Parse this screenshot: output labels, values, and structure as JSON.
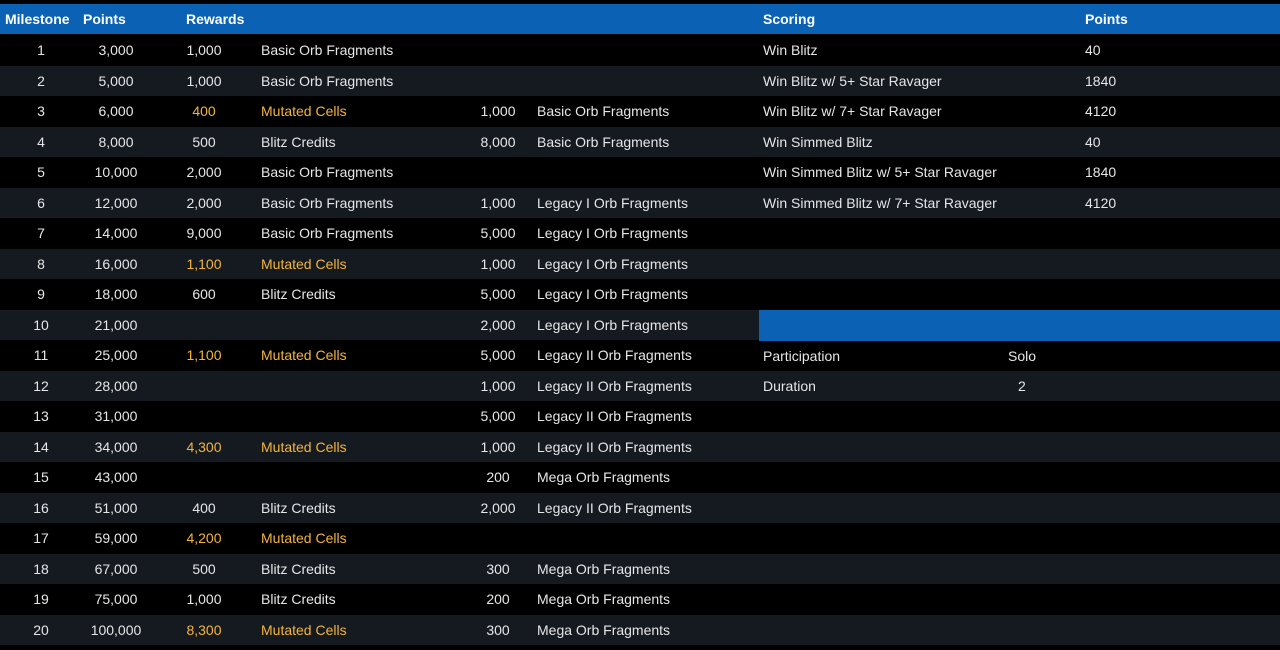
{
  "header": {
    "milestone": "Milestone",
    "points": "Points",
    "rewards": "Rewards",
    "scoring": "Scoring",
    "scoring_points": "Points"
  },
  "colors": {
    "header_bg": "#0b62b5",
    "row_alt": "#151a20",
    "highlight": "#f4b43a"
  },
  "milestones": [
    {
      "ms": "1",
      "pts": "3,000",
      "r1q": "1,000",
      "r1n": "Basic Orb Fragments",
      "r1hl": false,
      "r2q": "",
      "r2n": ""
    },
    {
      "ms": "2",
      "pts": "5,000",
      "r1q": "1,000",
      "r1n": "Basic Orb Fragments",
      "r1hl": false,
      "r2q": "",
      "r2n": ""
    },
    {
      "ms": "3",
      "pts": "6,000",
      "r1q": "400",
      "r1n": "Mutated Cells",
      "r1hl": true,
      "r2q": "1,000",
      "r2n": "Basic Orb Fragments"
    },
    {
      "ms": "4",
      "pts": "8,000",
      "r1q": "500",
      "r1n": "Blitz Credits",
      "r1hl": false,
      "r2q": "8,000",
      "r2n": "Basic Orb Fragments"
    },
    {
      "ms": "5",
      "pts": "10,000",
      "r1q": "2,000",
      "r1n": "Basic Orb Fragments",
      "r1hl": false,
      "r2q": "",
      "r2n": ""
    },
    {
      "ms": "6",
      "pts": "12,000",
      "r1q": "2,000",
      "r1n": "Basic Orb Fragments",
      "r1hl": false,
      "r2q": "1,000",
      "r2n": "Legacy I Orb Fragments"
    },
    {
      "ms": "7",
      "pts": "14,000",
      "r1q": "9,000",
      "r1n": "Basic Orb Fragments",
      "r1hl": false,
      "r2q": "5,000",
      "r2n": "Legacy I Orb Fragments"
    },
    {
      "ms": "8",
      "pts": "16,000",
      "r1q": "1,100",
      "r1n": "Mutated Cells",
      "r1hl": true,
      "r2q": "1,000",
      "r2n": "Legacy I Orb Fragments"
    },
    {
      "ms": "9",
      "pts": "18,000",
      "r1q": "600",
      "r1n": "Blitz Credits",
      "r1hl": false,
      "r2q": "5,000",
      "r2n": "Legacy I Orb Fragments"
    },
    {
      "ms": "10",
      "pts": "21,000",
      "r1q": "",
      "r1n": "",
      "r1hl": false,
      "r2q": "2,000",
      "r2n": "Legacy I Orb Fragments"
    },
    {
      "ms": "11",
      "pts": "25,000",
      "r1q": "1,100",
      "r1n": "Mutated Cells",
      "r1hl": true,
      "r2q": "5,000",
      "r2n": "Legacy II Orb Fragments"
    },
    {
      "ms": "12",
      "pts": "28,000",
      "r1q": "",
      "r1n": "",
      "r1hl": false,
      "r2q": "1,000",
      "r2n": "Legacy II Orb Fragments"
    },
    {
      "ms": "13",
      "pts": "31,000",
      "r1q": "",
      "r1n": "",
      "r1hl": false,
      "r2q": "5,000",
      "r2n": "Legacy II Orb Fragments"
    },
    {
      "ms": "14",
      "pts": "34,000",
      "r1q": "4,300",
      "r1n": "Mutated Cells",
      "r1hl": true,
      "r2q": "1,000",
      "r2n": "Legacy II Orb Fragments"
    },
    {
      "ms": "15",
      "pts": "43,000",
      "r1q": "",
      "r1n": "",
      "r1hl": false,
      "r2q": "200",
      "r2n": "Mega Orb Fragments"
    },
    {
      "ms": "16",
      "pts": "51,000",
      "r1q": "400",
      "r1n": "Blitz Credits",
      "r1hl": false,
      "r2q": "2,000",
      "r2n": "Legacy II Orb Fragments"
    },
    {
      "ms": "17",
      "pts": "59,000",
      "r1q": "4,200",
      "r1n": "Mutated Cells",
      "r1hl": true,
      "r2q": "",
      "r2n": ""
    },
    {
      "ms": "18",
      "pts": "67,000",
      "r1q": "500",
      "r1n": "Blitz Credits",
      "r1hl": false,
      "r2q": "300",
      "r2n": "Mega Orb Fragments"
    },
    {
      "ms": "19",
      "pts": "75,000",
      "r1q": "1,000",
      "r1n": "Blitz Credits",
      "r1hl": false,
      "r2q": "200",
      "r2n": "Mega Orb Fragments"
    },
    {
      "ms": "20",
      "pts": "100,000",
      "r1q": "8,300",
      "r1n": "Mutated Cells",
      "r1hl": true,
      "r2q": "300",
      "r2n": "Mega Orb Fragments"
    }
  ],
  "scoring": [
    {
      "label": "Win Blitz",
      "points": "40"
    },
    {
      "label": "Win Blitz w/ 5+ Star Ravager",
      "points": "1840"
    },
    {
      "label": "Win Blitz w/ 7+ Star Ravager",
      "points": "4120"
    },
    {
      "label": "Win Simmed Blitz",
      "points": "40"
    },
    {
      "label": "Win Simmed Blitz w/ 5+ Star Ravager",
      "points": "1840"
    },
    {
      "label": "Win Simmed Blitz w/ 7+ Star Ravager",
      "points": "4120"
    }
  ],
  "info": [
    {
      "label": "Participation",
      "value": "Solo"
    },
    {
      "label": "Duration",
      "value": "2"
    }
  ]
}
